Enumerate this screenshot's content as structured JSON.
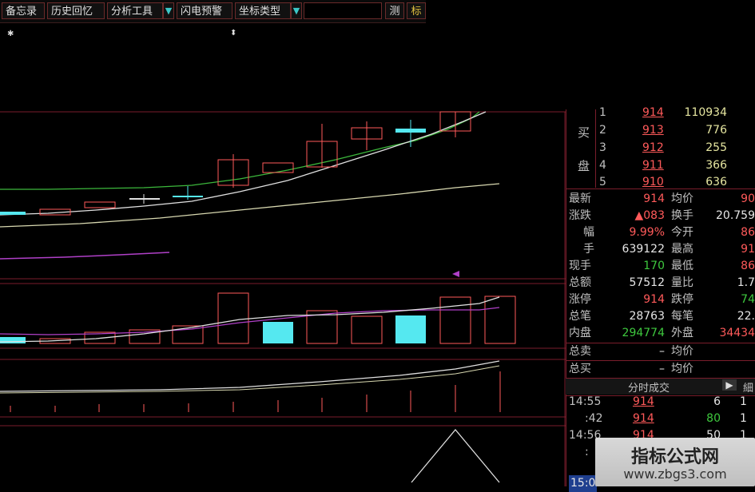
{
  "toolbar": {
    "memo": "备忘录",
    "history": "历史回忆",
    "analysis_tools": "分析工具",
    "flash_alert": "闪电预警",
    "coord_type": "坐标类型",
    "measure": "测",
    "mark": "标"
  },
  "order_book": {
    "buy_label_1": "买",
    "buy_label_2": "盘",
    "rows": [
      {
        "level": "1",
        "price": "914",
        "volume": "110934"
      },
      {
        "level": "2",
        "price": "913",
        "volume": "776"
      },
      {
        "level": "3",
        "price": "912",
        "volume": "255"
      },
      {
        "level": "4",
        "price": "911",
        "volume": "366"
      },
      {
        "level": "5",
        "price": "910",
        "volume": "636"
      }
    ]
  },
  "quote": {
    "latest_label": "最新",
    "latest": "914",
    "avg_label": "均价",
    "avg": "90",
    "change_label": "涨跌",
    "change": "▲083",
    "turnover_label": "换手",
    "turnover": "20.759",
    "pct_label": "幅",
    "pct": "9.99%",
    "open_label": "今开",
    "open": "86",
    "hands_label": "手",
    "hands": "639122",
    "high_label": "最高",
    "high": "91",
    "cur_label": "现手",
    "cur": "170",
    "low_label": "最低",
    "low": "86",
    "amount_label": "总额",
    "amount": "57512",
    "vol_ratio_label": "量比",
    "vol_ratio": "1.7",
    "limit_up_label": "涨停",
    "limit_up": "914",
    "limit_down_label": "跌停",
    "limit_down": "74",
    "trades_label": "总笔",
    "trades": "28763",
    "per_trade_label": "每笔",
    "per_trade": "22.",
    "inner_label": "内盘",
    "inner": "294774",
    "outer_label": "外盘",
    "outer": "34434",
    "total_sell_label": "总卖",
    "total_sell": "–",
    "total_sell_avg_label": "均价",
    "total_buy_label": "总买",
    "total_buy": "–",
    "total_buy_avg_label": "均价"
  },
  "ticks": {
    "header": "分时成交",
    "next_arrow": "▶",
    "detail": "細",
    "rows": [
      {
        "time": "14:55",
        "price": "914",
        "vol": "6",
        "n": "1"
      },
      {
        "time": ":42",
        "price": "914",
        "vol": "80",
        "n": "1"
      },
      {
        "time": "14:56",
        "price": "914",
        "vol": "50",
        "n": "1"
      },
      {
        "time": ":",
        "price": "",
        "vol": "",
        "n": ""
      },
      {
        "time": "15:0",
        "price": "",
        "vol": "",
        "n": ""
      }
    ]
  },
  "watermark": {
    "title": "指标公式网",
    "url": "www.zbgs3.com"
  },
  "colors": {
    "grid": "#7a1d2b",
    "up": "#ff5a5a",
    "down": "#55e8f0",
    "ma_green": "#3cb83c",
    "ma_white": "#e0e0e0",
    "ma_purple": "#b040c8"
  }
}
